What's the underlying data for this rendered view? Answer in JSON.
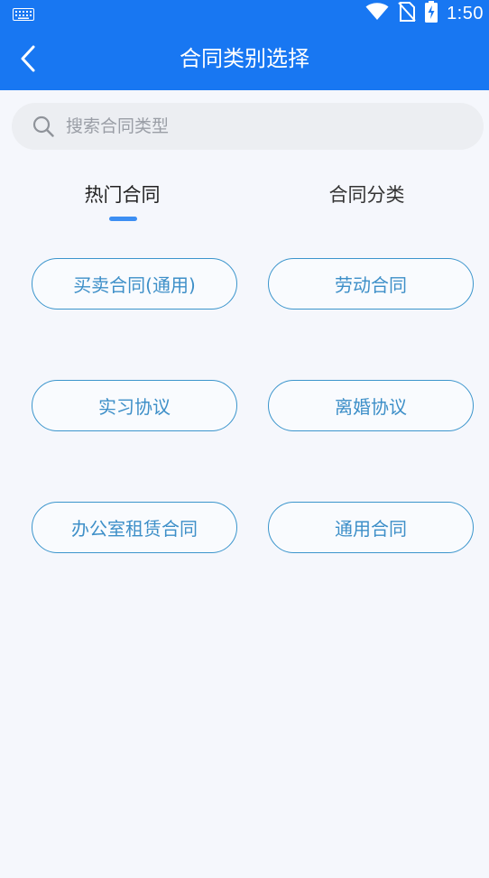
{
  "status_bar": {
    "time": "1:50",
    "icons": [
      "keyboard-icon",
      "wifi-icon",
      "no-sim-icon",
      "battery-charging-icon"
    ]
  },
  "header": {
    "title": "合同类别选择",
    "back_icon": "chevron-left-icon",
    "background_color": "#1877f2"
  },
  "search": {
    "placeholder": "搜索合同类型",
    "value": "",
    "icon": "search-icon"
  },
  "tabs": [
    {
      "label": "热门合同",
      "active": true
    },
    {
      "label": "合同分类",
      "active": false
    }
  ],
  "contracts": [
    {
      "label": "买卖合同(通用)"
    },
    {
      "label": "劳动合同"
    },
    {
      "label": "实习协议"
    },
    {
      "label": "离婚协议"
    },
    {
      "label": "办公室租赁合同"
    },
    {
      "label": "通用合同"
    }
  ],
  "colors": {
    "accent": "#3d8ff3",
    "option_border": "#3b95cc",
    "option_text": "#3d8fc8"
  }
}
